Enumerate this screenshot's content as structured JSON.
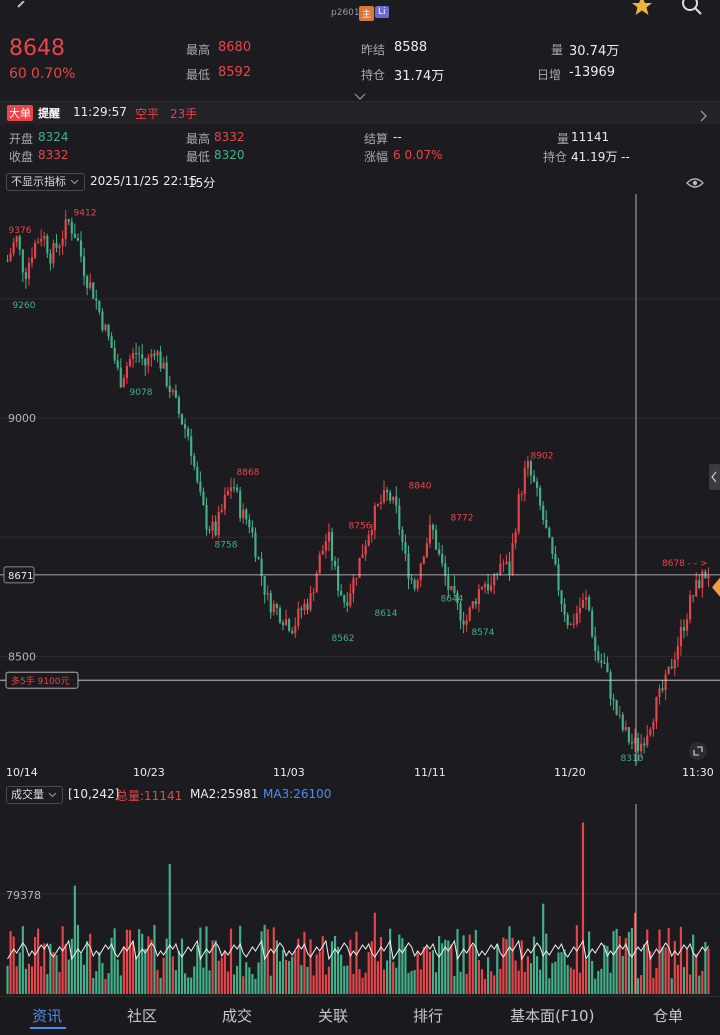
{
  "header": {
    "contract_code": "p2601",
    "badge_main": "主",
    "badge_li": "Li",
    "price": "8648",
    "change": "60",
    "change_pct": "0.70%",
    "stats": [
      {
        "label": "最高",
        "value": "8680",
        "color": "red"
      },
      {
        "label": "最低",
        "value": "8592",
        "color": "red"
      },
      {
        "label": "昨结",
        "value": "8588",
        "color": "white"
      },
      {
        "label": "持仓",
        "value": "31.74万",
        "color": "white"
      },
      {
        "label": "量",
        "value": "30.74万",
        "color": "white"
      },
      {
        "label": "日增",
        "value": "-13969",
        "color": "white"
      }
    ]
  },
  "alert": {
    "tag_a": "大单",
    "tag_b": "提醒",
    "time": "11:29:57",
    "direction": "空平",
    "qty": "23手"
  },
  "bar": {
    "open_label": "开盘",
    "open": "8324",
    "close_label": "收盘",
    "close": "8332",
    "high_label": "最高",
    "high": "8332",
    "low_label": "最低",
    "low": "8320",
    "settle_label": "结算",
    "settle": "--",
    "chg_label": "涨幅",
    "chg": "6 0.07%",
    "vol_label": "量",
    "vol": "11141",
    "oi_label": "持仓",
    "oi": "41.19万 --"
  },
  "toolbar": {
    "indicator_select": "不显示指标",
    "datetime": "2025/11/25 22:15",
    "period": "15分"
  },
  "chart_data": {
    "type": "candlestick",
    "price_axis_ticks": [
      "9000",
      "8500"
    ],
    "crosshair_price": "8671",
    "order_line_label": "多5手 9100元",
    "current_price_marker": "8678",
    "date_ticks": [
      "10/14",
      "10/23",
      "11/03",
      "11/11",
      "11/20",
      "11:30"
    ],
    "annotations": [
      {
        "text": "9376",
        "value": 9376,
        "kind": "high"
      },
      {
        "text": "9412",
        "value": 9412,
        "kind": "high"
      },
      {
        "text": "9260",
        "value": 9260,
        "kind": "low"
      },
      {
        "text": "9078",
        "value": 9078,
        "kind": "low"
      },
      {
        "text": "8868",
        "value": 8868,
        "kind": "high"
      },
      {
        "text": "8758",
        "value": 8758,
        "kind": "low"
      },
      {
        "text": "8756",
        "value": 8756,
        "kind": "high"
      },
      {
        "text": "8562",
        "value": 8562,
        "kind": "low"
      },
      {
        "text": "8614",
        "value": 8614,
        "kind": "low"
      },
      {
        "text": "8840",
        "value": 8840,
        "kind": "high"
      },
      {
        "text": "8644",
        "value": 8644,
        "kind": "low"
      },
      {
        "text": "8772",
        "value": 8772,
        "kind": "high"
      },
      {
        "text": "8574",
        "value": 8574,
        "kind": "low"
      },
      {
        "text": "8902",
        "value": 8902,
        "kind": "high"
      },
      {
        "text": "8310",
        "value": 8310,
        "kind": "low"
      }
    ],
    "price_path": [
      9330,
      9380,
      9300,
      9360,
      9390,
      9340,
      9370,
      9412,
      9380,
      9300,
      9260,
      9200,
      9150,
      9078,
      9120,
      9140,
      9110,
      9150,
      9100,
      9050,
      9000,
      8960,
      8850,
      8780,
      8760,
      8820,
      8868,
      8800,
      8780,
      8700,
      8620,
      8600,
      8580,
      8562,
      8600,
      8620,
      8700,
      8756,
      8660,
      8614,
      8660,
      8720,
      8780,
      8820,
      8840,
      8800,
      8700,
      8644,
      8720,
      8772,
      8700,
      8640,
      8600,
      8574,
      8620,
      8660,
      8640,
      8700,
      8680,
      8820,
      8902,
      8850,
      8780,
      8700,
      8620,
      8560,
      8600,
      8620,
      8500,
      8480,
      8400,
      8350,
      8320,
      8310,
      8350,
      8400,
      8440,
      8500,
      8560,
      8620,
      8660,
      8678
    ],
    "volume": {
      "label": "成交量",
      "param": "[10,242]",
      "total": "总量:11141",
      "ma2": "MA2:25981",
      "ma3": "MA3:26100",
      "axis_tick": "79378"
    }
  },
  "nav": [
    {
      "label": "资讯",
      "active": true
    },
    {
      "label": "社区",
      "active": false
    },
    {
      "label": "成交",
      "active": false
    },
    {
      "label": "关联",
      "active": false
    },
    {
      "label": "排行",
      "active": false
    },
    {
      "label": "基本面(F10)",
      "active": false
    },
    {
      "label": "仓单",
      "active": false
    }
  ],
  "colors": {
    "up": "#e8454a",
    "down": "#43b089",
    "accent": "#4a8cf0",
    "ma": "#ffffff"
  }
}
